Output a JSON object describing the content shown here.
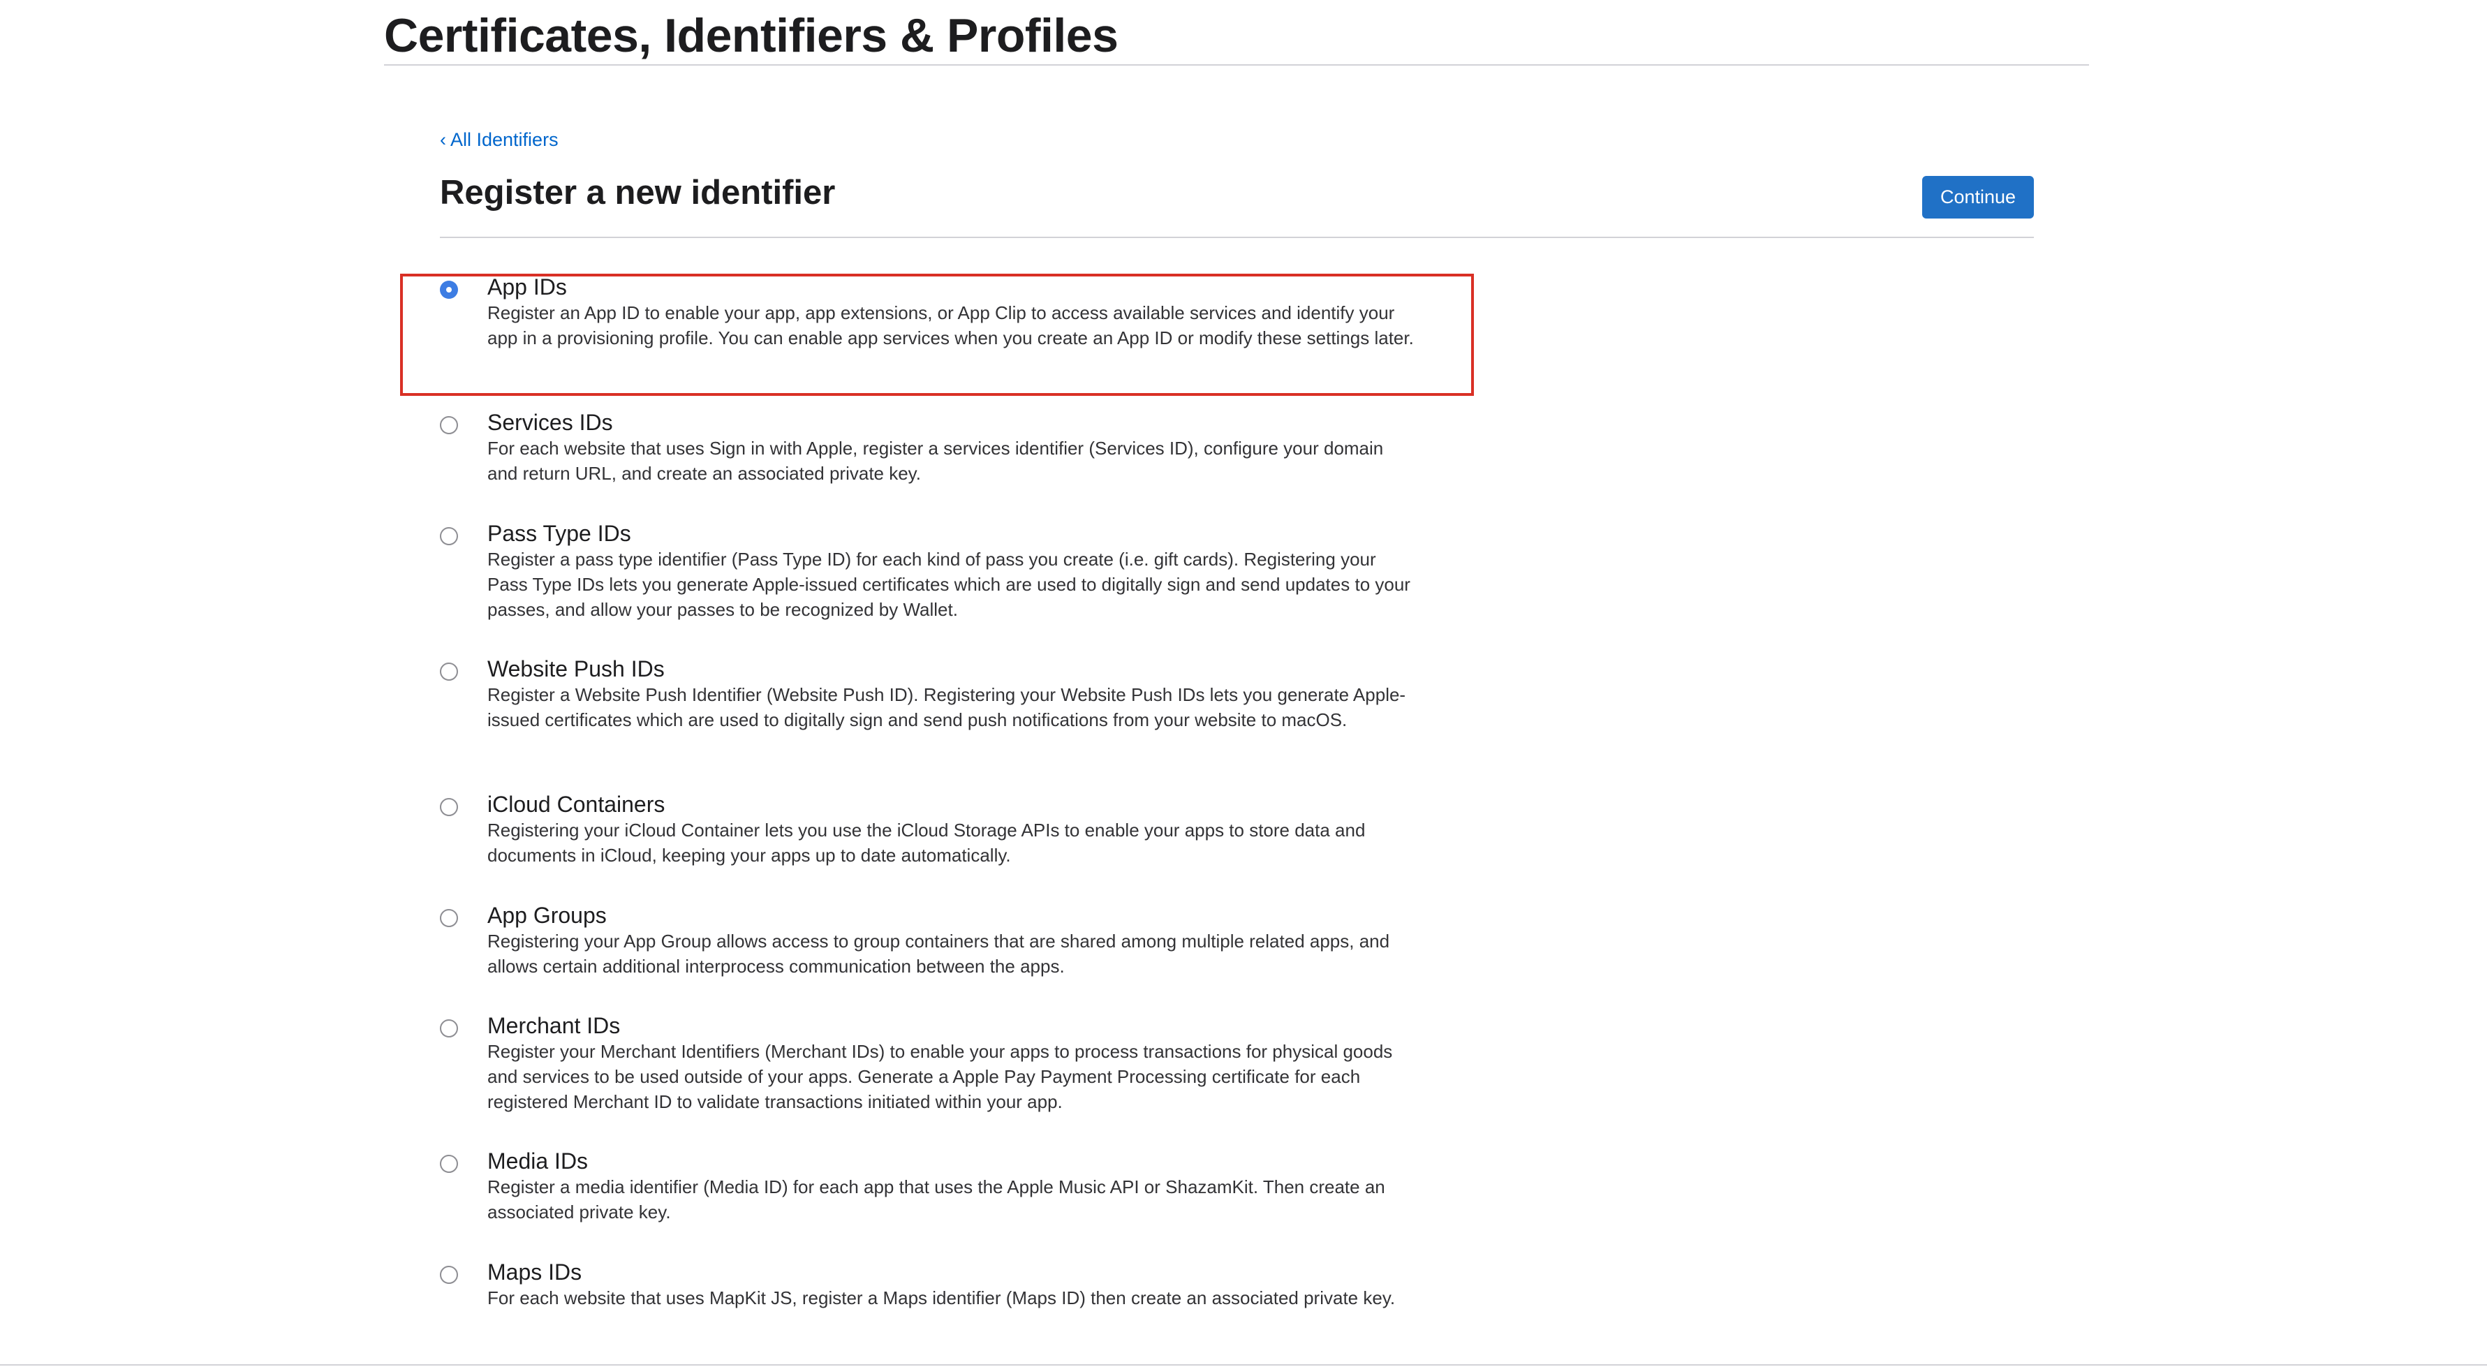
{
  "header": {
    "title": "Certificates, Identifiers & Profiles"
  },
  "content": {
    "back_link": "‹ All Identifiers",
    "section_title": "Register a new identifier",
    "continue_label": "Continue"
  },
  "options": [
    {
      "title": "App IDs",
      "description": "Register an App ID to enable your app, app extensions, or App Clip to access available services and identify your app in a provisioning profile. You can enable app services when you create an App ID or modify these settings later.",
      "selected": true
    },
    {
      "title": "Services IDs",
      "description": "For each website that uses Sign in with Apple, register a services identifier (Services ID), configure your domain and return URL, and create an associated private key.",
      "selected": false
    },
    {
      "title": "Pass Type IDs",
      "description": "Register a pass type identifier (Pass Type ID) for each kind of pass you create (i.e. gift cards). Registering your Pass Type IDs lets you generate Apple-issued certificates which are used to digitally sign and send updates to your passes, and allow your passes to be recognized by Wallet.",
      "selected": false
    },
    {
      "title": "Website Push IDs",
      "description": "Register a Website Push Identifier (Website Push ID). Registering your Website Push IDs lets you generate Apple-issued certificates which are used to digitally sign and send push notifications from your website to macOS.",
      "selected": false
    },
    {
      "title": "iCloud Containers",
      "description": "Registering your iCloud Container lets you use the iCloud Storage APIs to enable your apps to store data and documents in iCloud, keeping your apps up to date automatically.",
      "selected": false
    },
    {
      "title": "App Groups",
      "description": "Registering your App Group allows access to group containers that are shared among multiple related apps, and allows certain additional interprocess communication between the apps.",
      "selected": false
    },
    {
      "title": "Merchant IDs",
      "description": "Register your Merchant Identifiers (Merchant IDs) to enable your apps to process transactions for physical goods and services to be used outside of your apps. Generate a Apple Pay Payment Processing certificate for each registered Merchant ID to validate transactions initiated within your app.",
      "selected": false
    },
    {
      "title": "Media IDs",
      "description": "Register a media identifier (Media ID) for each app that uses the Apple Music API or ShazamKit. Then create an associated private key.",
      "selected": false
    },
    {
      "title": "Maps IDs",
      "description": "For each website that uses MapKit JS, register a Maps identifier (Maps ID) then create an associated private key.",
      "selected": false
    }
  ],
  "colors": {
    "accent": "#2071c6",
    "link": "#0066cc",
    "radio_selected": "#3d7de3",
    "highlight": "#d93025"
  }
}
